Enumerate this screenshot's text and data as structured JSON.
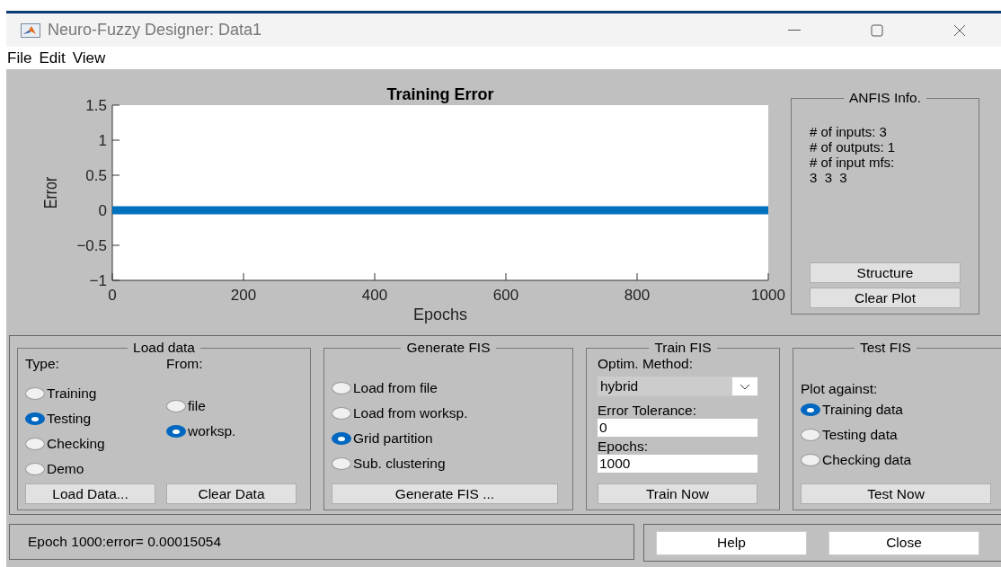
{
  "window": {
    "title": "Neuro-Fuzzy Designer: Data1"
  },
  "menu": [
    "File",
    "Edit",
    "View"
  ],
  "plot": {
    "chart_data": {
      "type": "line",
      "title": "Training Error",
      "xlabel": "Epochs",
      "ylabel": "Error",
      "x": [
        0,
        1000
      ],
      "series": [
        {
          "color": "#0072bd",
          "values": [
            0,
            0
          ]
        }
      ],
      "xlim": [
        0,
        1000
      ],
      "ylim": [
        -1,
        1.5
      ],
      "xticks": [
        0,
        200,
        400,
        600,
        800,
        1000
      ],
      "yticks": [
        -1,
        -0.5,
        0,
        0.5,
        1,
        1.5
      ]
    }
  },
  "anfis_info": {
    "title": "ANFIS Info.",
    "lines": [
      "# of inputs: 3",
      "# of outputs: 1",
      "# of input mfs:",
      "3  3  3"
    ],
    "buttons": [
      "Structure",
      "Clear Plot"
    ]
  },
  "load_data": {
    "title": "Load data",
    "type_label": "Type:",
    "from_label": "From:",
    "types": [
      {
        "label": "Training",
        "selected": false
      },
      {
        "label": "Testing",
        "selected": true
      },
      {
        "label": "Checking",
        "selected": false
      },
      {
        "label": "Demo",
        "selected": false
      }
    ],
    "sources": [
      {
        "label": "file",
        "selected": false
      },
      {
        "label": "worksp.",
        "selected": true
      }
    ],
    "buttons": [
      "Load Data...",
      "Clear Data"
    ]
  },
  "generate_fis": {
    "title": "Generate FIS",
    "options": [
      {
        "label": "Load from file",
        "selected": false
      },
      {
        "label": "Load from worksp.",
        "selected": false
      },
      {
        "label": "Grid partition",
        "selected": true
      },
      {
        "label": "Sub. clustering",
        "selected": false
      }
    ],
    "button": "Generate FIS ..."
  },
  "train_fis": {
    "title": "Train FIS",
    "method_label": "Optim. Method:",
    "method": "hybrid",
    "tolerance_label": "Error Tolerance:",
    "tolerance": "0",
    "epochs_label": "Epochs:",
    "epochs": "1000",
    "button": "Train Now"
  },
  "test_fis": {
    "title": "Test FIS",
    "plot_label": "Plot against:",
    "options": [
      {
        "label": "Training data",
        "selected": true
      },
      {
        "label": "Testing data",
        "selected": false
      },
      {
        "label": "Checking data",
        "selected": false
      }
    ],
    "button": "Test Now"
  },
  "status": "Epoch 1000:error= 0.00015054",
  "footer_buttons": [
    "Help",
    "Close"
  ]
}
